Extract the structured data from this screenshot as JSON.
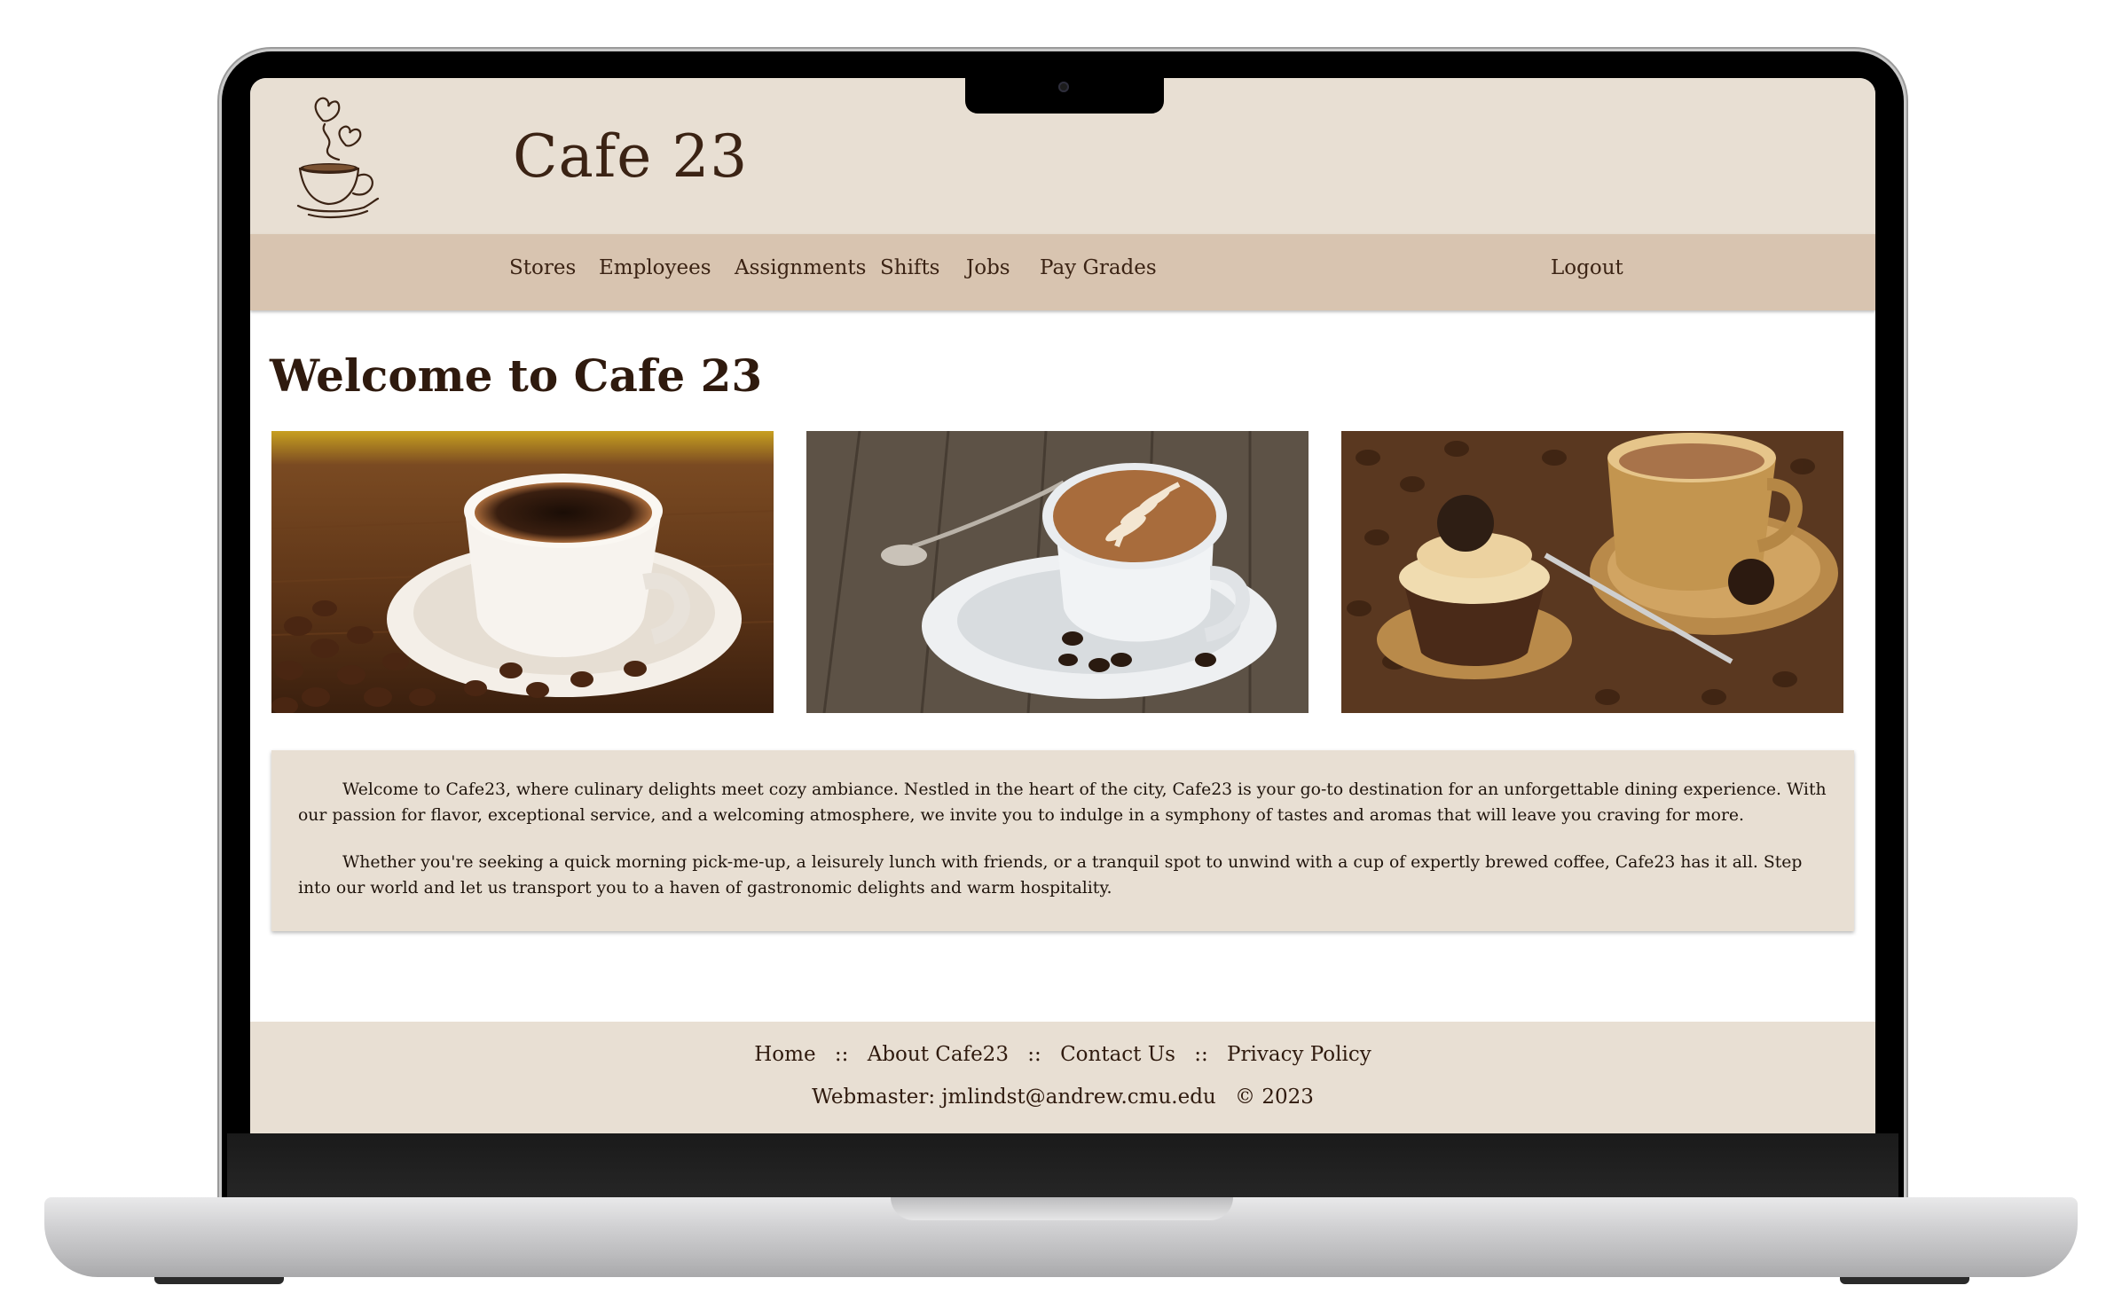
{
  "site": {
    "title": "Cafe 23"
  },
  "nav": {
    "stores": "Stores",
    "employees": "Employees",
    "assignments": "Assignments",
    "shifts": "Shifts",
    "jobs": "Jobs",
    "pay_grades": "Pay Grades",
    "logout": "Logout"
  },
  "main": {
    "heading": "Welcome to Cafe 23",
    "photos": [
      {
        "subject": "white cup of black coffee with coffee beans"
      },
      {
        "subject": "latte art cup with spoon on wooden table"
      },
      {
        "subject": "cupcake and coffee cup on coffee beans"
      }
    ],
    "paragraphs": [
      "Welcome to Cafe23, where culinary delights meet cozy ambiance. Nestled in the heart of the city, Cafe23 is your go-to destination for an unforgettable dining experience. With our passion for flavor, exceptional service, and a welcoming atmosphere, we invite you to indulge in a symphony of tastes and aromas that will leave you craving for more.",
      "Whether you're seeking a quick morning pick-me-up, a leisurely lunch with friends, or a tranquil spot to unwind with a cup of expertly brewed coffee, Cafe23 has it all. Step into our world and let us transport you to a haven of gastronomic delights and warm hospitality."
    ]
  },
  "footer": {
    "home": "Home",
    "about": "About Cafe23",
    "contact": "Contact Us",
    "privacy": "Privacy Policy",
    "separator": "::",
    "webmaster": "Webmaster: jmlindst@andrew.cmu.edu",
    "copyright": "© 2023"
  },
  "colors": {
    "header_bg": "#e8dfd3",
    "nav_bg": "#d8c4b0",
    "text_brown": "#3b2314"
  },
  "icons": [
    "coffee-cup-logo-icon"
  ]
}
